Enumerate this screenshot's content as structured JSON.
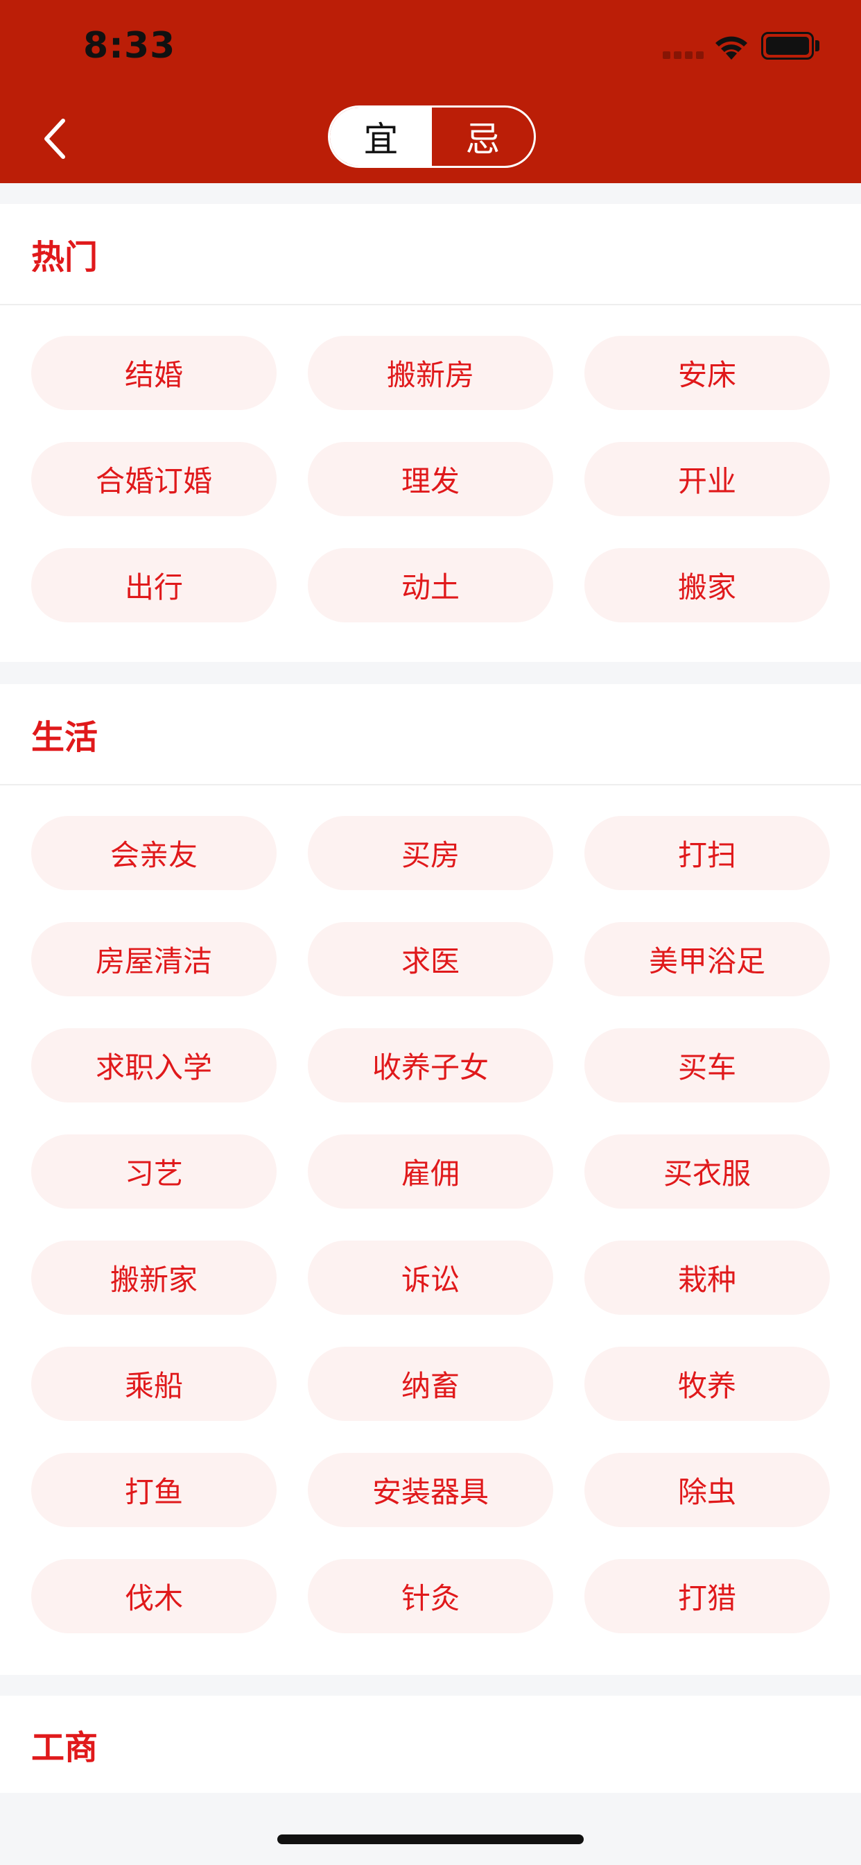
{
  "status_bar": {
    "time": "8:33"
  },
  "nav": {
    "back_icon": "chevron-left-icon",
    "segments": [
      {
        "label": "宜",
        "selected": true
      },
      {
        "label": "忌",
        "selected": false
      }
    ]
  },
  "sections": [
    {
      "title": "热门",
      "items": [
        "结婚",
        "搬新房",
        "安床",
        "合婚订婚",
        "理发",
        "开业",
        "出行",
        "动土",
        "搬家"
      ]
    },
    {
      "title": "生活",
      "items": [
        "会亲友",
        "买房",
        "打扫",
        "房屋清洁",
        "求医",
        "美甲浴足",
        "求职入学",
        "收养子女",
        "买车",
        "习艺",
        "雇佣",
        "买衣服",
        "搬新家",
        "诉讼",
        "栽种",
        "乘船",
        "纳畜",
        "牧养",
        "打鱼",
        "安装器具",
        "除虫",
        "伐木",
        "针灸",
        "打猎"
      ]
    },
    {
      "title": "工商",
      "items": []
    }
  ],
  "colors": {
    "header_bg": "#bb1e07",
    "accent": "#e0191b",
    "chip_bg": "#fdf2f1",
    "page_bg": "#f5f6f8"
  }
}
